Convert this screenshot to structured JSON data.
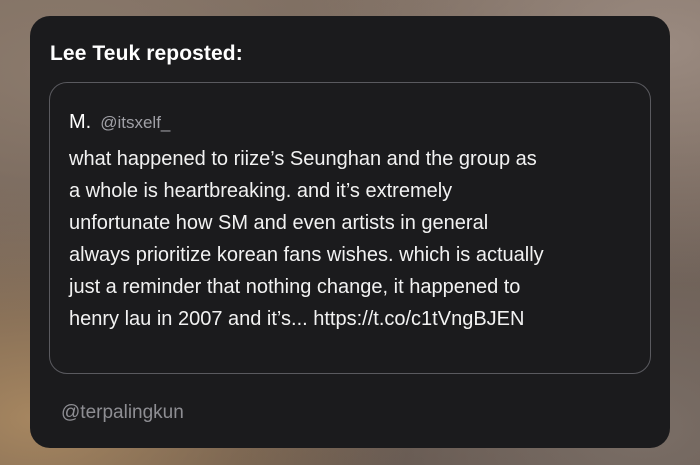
{
  "card": {
    "header": "Lee Teuk reposted:",
    "quote": {
      "author_name": "M.",
      "author_handle": "@itsxelf_",
      "lines": [
        "what happened to riize’s Seunghan and the group as",
        "a whole is heartbreaking. and it’s extremely",
        "unfortunate how SM and even artists in general",
        "always prioritize korean fans wishes. which is actually",
        "just a reminder that nothing change, it happened to",
        "henry lau in 2007 and it’s... https://t.co/c1tVngBJEN"
      ]
    },
    "footer_handle": "@terpalingkun"
  },
  "colors": {
    "card_background": "#1b1b1d",
    "quote_border": "#5a5a5f",
    "primary_text": "#ffffff",
    "secondary_text": "#8e8e93"
  }
}
